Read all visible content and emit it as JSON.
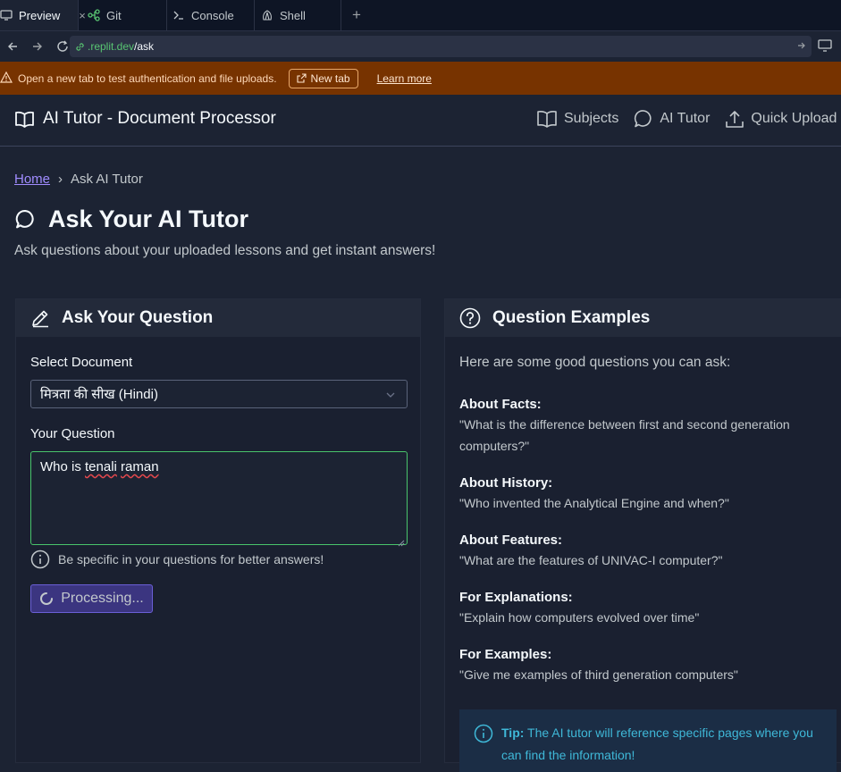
{
  "ide_tabs": [
    {
      "label": "Preview",
      "icon": "monitor-icon",
      "close": "×"
    },
    {
      "label": "Git",
      "icon": "git-icon"
    },
    {
      "label": "Console",
      "icon": "terminal-icon"
    },
    {
      "label": "Shell",
      "icon": "shell-icon"
    }
  ],
  "ide_add_tab": "+",
  "url": {
    "host": ".replit.dev",
    "path": "/ask"
  },
  "banner": {
    "message": "Open a new tab to test authentication and file uploads.",
    "button": "New tab",
    "link": "Learn more"
  },
  "header": {
    "brand": "AI Tutor - Document Processor",
    "nav": [
      "Subjects",
      "AI Tutor",
      "Quick Upload"
    ]
  },
  "breadcrumb": {
    "home": "Home",
    "separator": "›",
    "current": "Ask AI Tutor"
  },
  "page": {
    "title": "Ask Your AI Tutor",
    "subtitle": "Ask questions about your uploaded lessons and get instant answers!"
  },
  "question_card": {
    "title": "Ask Your Question",
    "document_label": "Select Document",
    "document_value": "मित्रता की सीख (Hindi)",
    "question_label": "Your Question",
    "question_value_words": [
      "Who is",
      "tenali",
      "raman"
    ],
    "hint": "Be specific in your questions for better answers!",
    "submit_label": "Processing..."
  },
  "examples_card": {
    "title": "Question Examples",
    "intro": "Here are some good questions you can ask:",
    "items": [
      {
        "title": "About Facts:",
        "text": "\"What is the difference between first and second generation computers?\""
      },
      {
        "title": "About History:",
        "text": "\"Who invented the Analytical Engine and when?\""
      },
      {
        "title": "About Features:",
        "text": "\"What are the features of UNIVAC-I computer?\""
      },
      {
        "title": "For Explanations:",
        "text": "\"Explain how computers evolved over time\""
      },
      {
        "title": "For Examples:",
        "text": "\"Give me examples of third generation computers\""
      }
    ],
    "tip_label": "Tip:",
    "tip_text": "The AI tutor will reference specific pages where you can find the information!"
  },
  "colors": {
    "accent": "#a08cff",
    "success_border": "#49c46b",
    "banner_bg": "#773300",
    "tip": "#3fb8d8"
  }
}
